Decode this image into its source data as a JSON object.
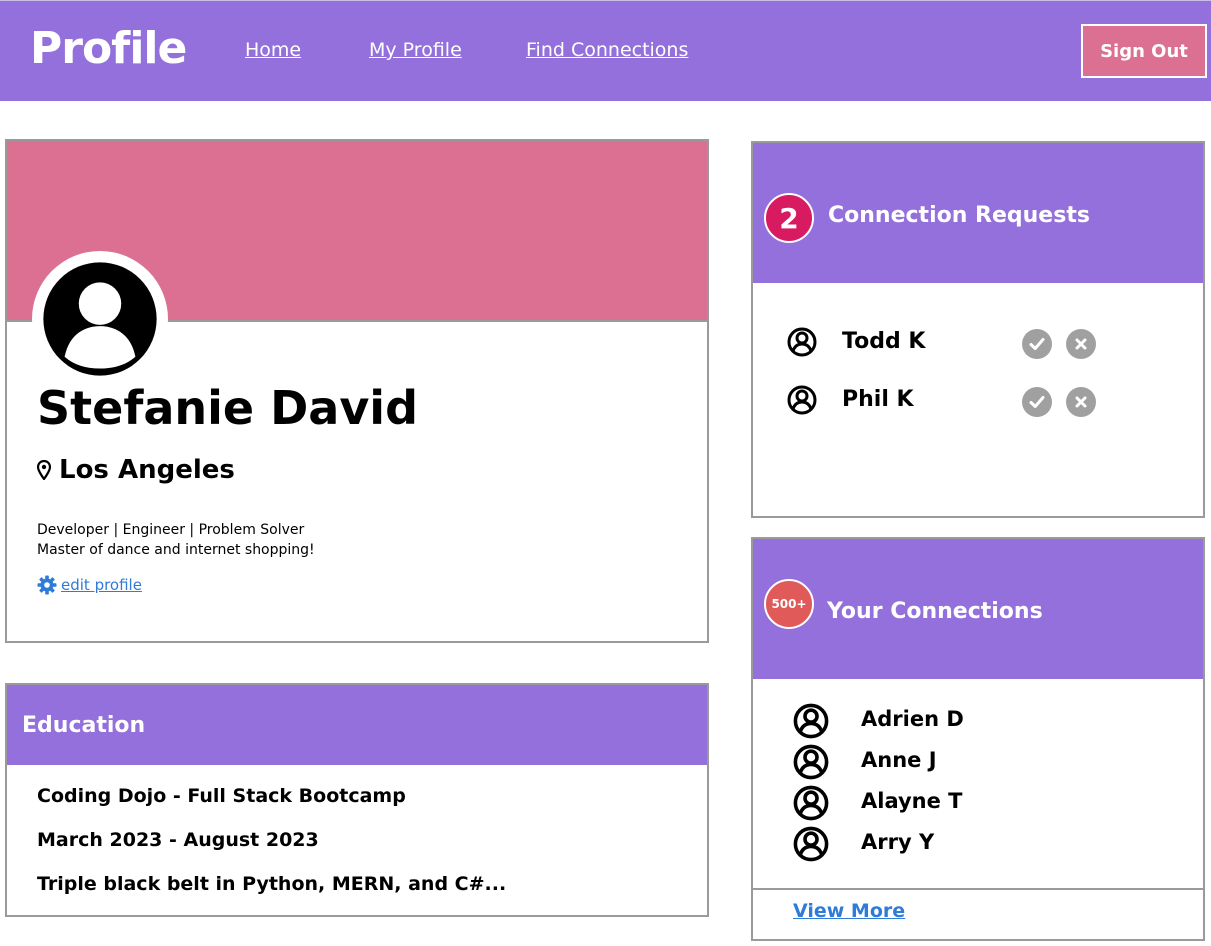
{
  "header": {
    "brand": "Profile",
    "nav": [
      "Home",
      "My Profile",
      "Find Connections"
    ],
    "sign_out": "Sign Out"
  },
  "profile": {
    "name": "Stefanie David",
    "location": "Los Angeles",
    "bio_line1": "Developer | Engineer | Problem Solver",
    "bio_line2": "Master of dance and internet shopping!",
    "edit_label": "edit profile"
  },
  "education": {
    "title": "Education",
    "school": "Coding Dojo - Full Stack Bootcamp",
    "dates": "March 2023 - August 2023",
    "description": "Triple black belt in Python, MERN, and C#..."
  },
  "requests": {
    "count": "2",
    "title": "Connection Requests",
    "people": [
      "Todd K",
      "Phil K"
    ]
  },
  "connections": {
    "count": "500+",
    "title": "Your Connections",
    "people": [
      "Adrien D",
      "Anne J",
      "Alayne T",
      "Arry Y"
    ],
    "view_more": "View More"
  },
  "colors": {
    "purple": "#9370db",
    "pink": "#db7093",
    "badge_magenta": "#d81b60",
    "badge_red": "#e05a5a",
    "link_blue": "#2f7bd8",
    "action_gray": "#a0a0a0"
  },
  "icons": [
    "user-avatar-icon",
    "map-pin-icon",
    "gear-icon",
    "check-icon",
    "close-icon"
  ]
}
